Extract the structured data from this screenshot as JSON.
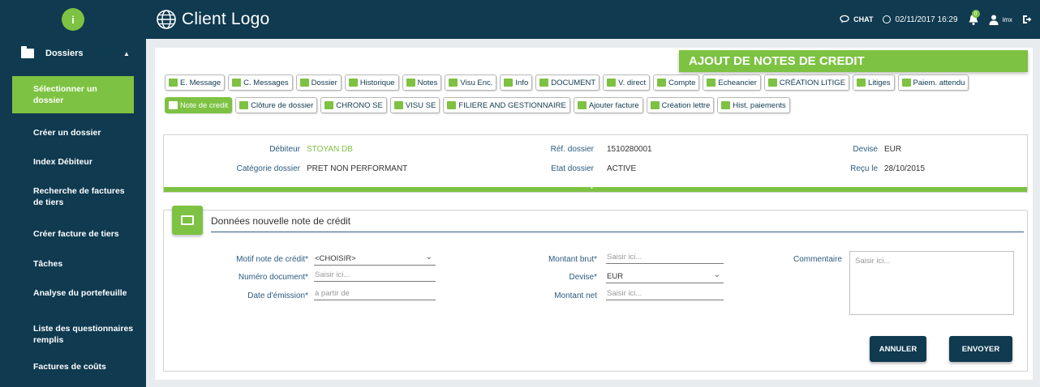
{
  "header": {
    "brand": "Client Logo",
    "chat_label": "CHAT",
    "datetime": "02/11/2017 16:29",
    "notif_count": "0",
    "user": "imx"
  },
  "sidebar": {
    "logo": "i",
    "section_label": "Dossiers",
    "items": [
      {
        "label": "Sélectionner un dossier"
      },
      {
        "label": "Créer un dossier"
      },
      {
        "label": "Index Débiteur"
      },
      {
        "label": "Recherche de factures de tiers"
      },
      {
        "label": "Créer facture de tiers"
      },
      {
        "label": "Tâches"
      },
      {
        "label": "Analyse du portefeuille"
      },
      {
        "label": "Liste des questionnaires remplis"
      },
      {
        "label": "Factures de coûts"
      }
    ]
  },
  "page_title": "AJOUT DE NOTES DE CREDIT",
  "toolbar_row1": [
    "E. Message",
    "C. Messages",
    "Dossier",
    "Historique",
    "Notes",
    "Visu Enc.",
    "Info",
    "DOCUMENT",
    "V. direct",
    "Compte",
    "Echeancier",
    "CRÉATION LITIGE",
    "Litiges",
    "Paiem. attendu"
  ],
  "toolbar_row2": [
    "Note de credit",
    "Clôture de dossier",
    "CHRONO SE",
    "VISU SE",
    "FILIERE AND GESTIONNAIRE",
    "Ajouter facture",
    "Création lettre",
    "Hist. paiements"
  ],
  "info": {
    "debiteur_label": "Débiteur",
    "debiteur_value": "STOYAN DB",
    "categorie_label": "Catégorie dossier",
    "categorie_value": "PRET NON PERFORMANT",
    "ref_label": "Réf. dossier",
    "ref_value": "1510280001",
    "etat_label": "Etat dossier",
    "etat_value": "ACTIVE",
    "devise_label": "Devise",
    "devise_value": "EUR",
    "recu_label": "Reçu le",
    "recu_value": "28/10/2015"
  },
  "form": {
    "title": "Données nouvelle note de crédit",
    "motif_label": "Motif note de crédit*",
    "motif_value": "<CHOISIR>",
    "numero_label": "Numéro document*",
    "numero_placeholder": "Saisir ici...",
    "date_label": "Date d'émission*",
    "date_placeholder": "à partir de",
    "brut_label": "Montant brut*",
    "brut_placeholder": "Saisir ici...",
    "devise_label": "Devise*",
    "devise_value": "EUR",
    "net_label": "Montant net",
    "net_placeholder": "Saisir ici...",
    "commentaire_label": "Commentaire",
    "commentaire_placeholder": "Saisir ici...",
    "cancel_label": "ANNULER",
    "submit_label": "ENVOYER"
  },
  "colors": {
    "brand_dark": "#0f3a50",
    "accent_green": "#7dc242"
  }
}
